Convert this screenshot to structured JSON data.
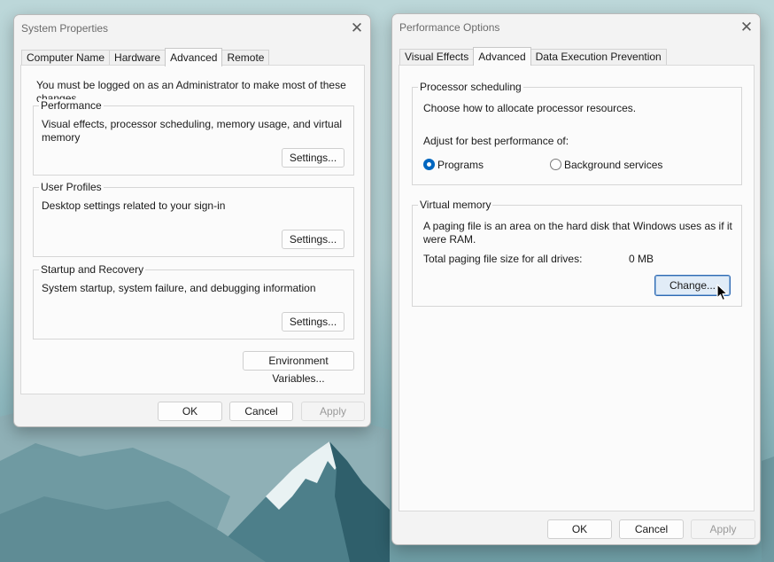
{
  "system_properties": {
    "title": "System Properties",
    "tabs": [
      "Computer Name",
      "Hardware",
      "Advanced",
      "Remote"
    ],
    "active_tab": "Advanced",
    "admin_notice": "You must be logged on as an Administrator to make most of these changes.",
    "performance": {
      "label": "Performance",
      "description": "Visual effects, processor scheduling, memory usage, and virtual memory",
      "button": "Settings..."
    },
    "user_profiles": {
      "label": "User Profiles",
      "description": "Desktop settings related to your sign-in",
      "button": "Settings..."
    },
    "startup_recovery": {
      "label": "Startup and Recovery",
      "description": "System startup, system failure, and debugging information",
      "button": "Settings..."
    },
    "env_button": "Environment Variables...",
    "ok": "OK",
    "cancel": "Cancel",
    "apply": "Apply"
  },
  "performance_options": {
    "title": "Performance Options",
    "tabs": [
      "Visual Effects",
      "Advanced",
      "Data Execution Prevention"
    ],
    "active_tab": "Advanced",
    "processor_scheduling": {
      "label": "Processor scheduling",
      "description": "Choose how to allocate processor resources.",
      "adjust_label": "Adjust for best performance of:",
      "options": [
        "Programs",
        "Background services"
      ],
      "selected": "Programs"
    },
    "virtual_memory": {
      "label": "Virtual memory",
      "description": "A paging file is an area on the hard disk that Windows uses as if it were RAM.",
      "total_label": "Total paging file size for all drives:",
      "total_value": "0 MB",
      "button": "Change..."
    },
    "ok": "OK",
    "cancel": "Cancel",
    "apply": "Apply"
  },
  "colors": {
    "accent": "#0067c0",
    "focus_border": "#2f6ab3",
    "disabled_text": "#9a9a9a"
  }
}
